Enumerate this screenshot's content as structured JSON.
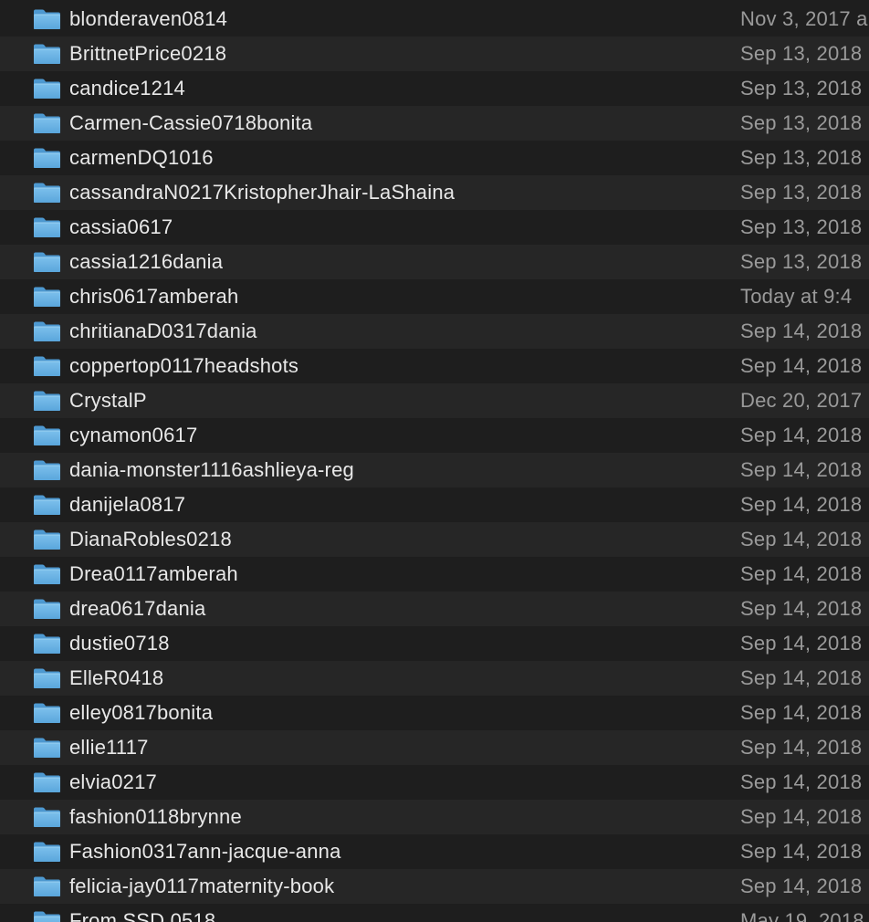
{
  "rows": [
    {
      "name": "blonderaven0814",
      "date": "Nov 3, 2017 a"
    },
    {
      "name": "BrittnetPrice0218",
      "date": "Sep 13, 2018"
    },
    {
      "name": "candice1214",
      "date": "Sep 13, 2018"
    },
    {
      "name": "Carmen-Cassie0718bonita",
      "date": "Sep 13, 2018"
    },
    {
      "name": "carmenDQ1016",
      "date": "Sep 13, 2018"
    },
    {
      "name": "cassandraN0217KristopherJhair-LaShaina",
      "date": "Sep 13, 2018"
    },
    {
      "name": "cassia0617",
      "date": "Sep 13, 2018"
    },
    {
      "name": "cassia1216dania",
      "date": "Sep 13, 2018"
    },
    {
      "name": "chris0617amberah",
      "date": "Today at 9:4"
    },
    {
      "name": "chritianaD0317dania",
      "date": "Sep 14, 2018"
    },
    {
      "name": "coppertop0117headshots",
      "date": "Sep 14, 2018"
    },
    {
      "name": "CrystalP",
      "date": "Dec 20, 2017"
    },
    {
      "name": "cynamon0617",
      "date": "Sep 14, 2018"
    },
    {
      "name": "dania-monster1116ashlieya-reg",
      "date": "Sep 14, 2018"
    },
    {
      "name": "danijela0817",
      "date": "Sep 14, 2018"
    },
    {
      "name": "DianaRobles0218",
      "date": "Sep 14, 2018"
    },
    {
      "name": "Drea0117amberah",
      "date": "Sep 14, 2018"
    },
    {
      "name": "drea0617dania",
      "date": "Sep 14, 2018"
    },
    {
      "name": "dustie0718",
      "date": "Sep 14, 2018"
    },
    {
      "name": "ElleR0418",
      "date": "Sep 14, 2018"
    },
    {
      "name": "elley0817bonita",
      "date": "Sep 14, 2018"
    },
    {
      "name": "ellie1117",
      "date": "Sep 14, 2018"
    },
    {
      "name": "elvia0217",
      "date": "Sep 14, 2018"
    },
    {
      "name": "fashion0118brynne",
      "date": "Sep 14, 2018"
    },
    {
      "name": "Fashion0317ann-jacque-anna",
      "date": "Sep 14, 2018"
    },
    {
      "name": "felicia-jay0117maternity-book",
      "date": "Sep 14, 2018"
    },
    {
      "name": "From SSD 0518",
      "date": "May 19, 2018"
    }
  ],
  "icon": "folder-icon",
  "colors": {
    "folder": "#5fa8dc",
    "row_even": "#1e1e1e",
    "row_odd": "#262626",
    "name_text": "#e8e8e8",
    "date_text": "#9a9a9a"
  }
}
